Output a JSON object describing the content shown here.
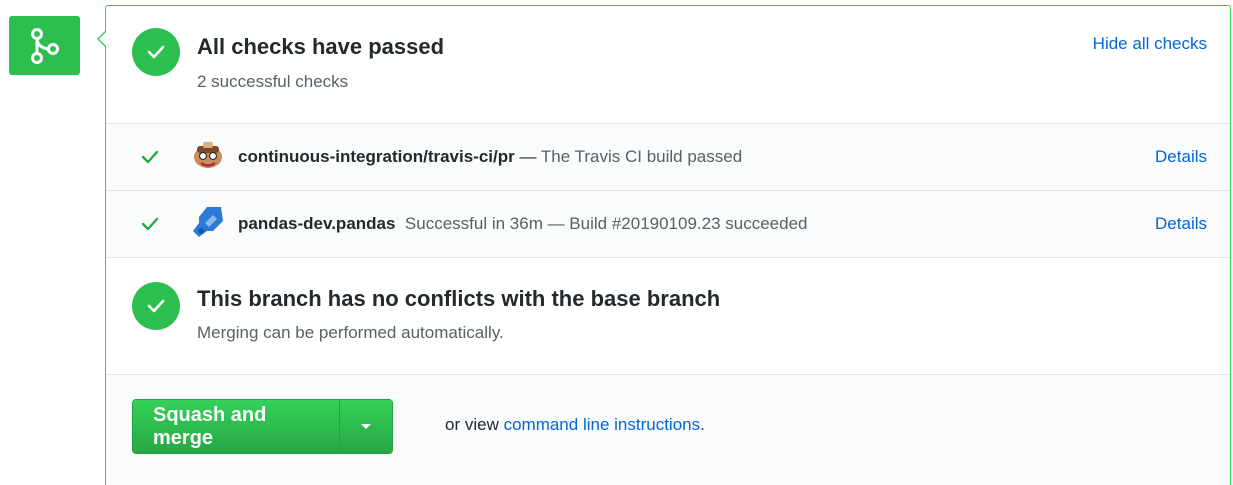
{
  "checks_header": {
    "title": "All checks have passed",
    "subtitle": "2 successful checks",
    "hide_link": "Hide all checks"
  },
  "checks": [
    {
      "name": "continuous-integration/travis-ci/pr",
      "separator": " — ",
      "description": "The Travis CI build passed",
      "details_label": "Details",
      "avatar_icon": "travis-ci-icon"
    },
    {
      "name": "pandas-dev.pandas",
      "separator": "  ",
      "description": "Successful in 36m — Build #20190109.23 succeeded",
      "details_label": "Details",
      "avatar_icon": "azure-pipelines-icon"
    }
  ],
  "branch_status": {
    "title": "This branch has no conflicts with the base branch",
    "subtitle": "Merging can be performed automatically."
  },
  "merge": {
    "button_label": "Squash and merge",
    "or_view_text": "or view ",
    "instructions_link": "command line instructions",
    "trailing": "."
  },
  "colors": {
    "success_green": "#2cbe4e",
    "link_blue": "#0366d6",
    "border_green": "#34d058"
  }
}
